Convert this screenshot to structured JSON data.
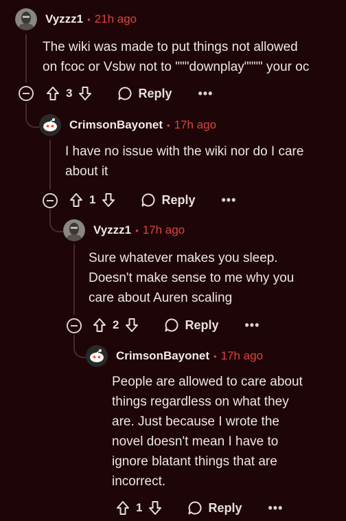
{
  "comments": [
    {
      "username": "Vyzzz1",
      "separator": "•",
      "time": "21h ago",
      "body_lines": [
        "The wiki was made to put things not allowed",
        "on fcoc or Vsbw not to \"\"\"downplay\"\"\"\" your oc"
      ],
      "votes": "3",
      "reply_label": "Reply",
      "more_label": "•••",
      "avatar": "grey-masked-figure-avatar"
    },
    {
      "username": "CrimsonBayonet",
      "separator": "•",
      "time": "17h ago",
      "body_lines": [
        "I have no issue with the wiki nor do I care",
        "about it"
      ],
      "votes": "1",
      "reply_label": "Reply",
      "more_label": "•••",
      "avatar": "reddit-snoo-avatar"
    },
    {
      "username": "Vyzzz1",
      "separator": "•",
      "time": "17h ago",
      "body_lines": [
        "Sure whatever makes you sleep.",
        "Doesn't make sense to me why you",
        "care about Auren scaling"
      ],
      "votes": "2",
      "reply_label": "Reply",
      "more_label": "•••",
      "avatar": "grey-masked-figure-avatar"
    },
    {
      "username": "CrimsonBayonet",
      "separator": "•",
      "time": "17h ago",
      "body_lines": [
        "People are allowed to care about",
        "things regardless on what they",
        "are. Just because I wrote the",
        "novel doesn't mean I have to",
        "ignore blatant things that are",
        "incorrect."
      ],
      "votes": "1",
      "reply_label": "Reply",
      "more_label": "•••",
      "avatar": "reddit-snoo-avatar"
    }
  ],
  "colors": {
    "background": "#1e0507",
    "accent_time": "#d9463f",
    "text": "#ece6e6",
    "thread_line": "#4a2a2c"
  }
}
